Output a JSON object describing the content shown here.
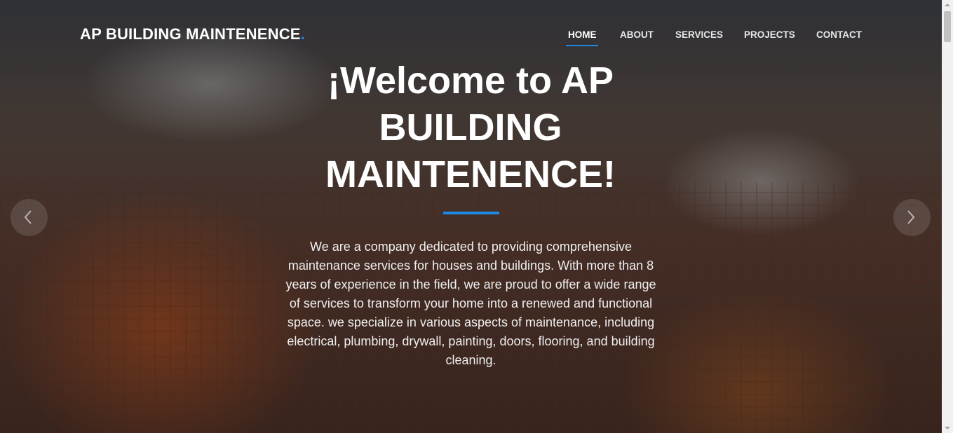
{
  "brand": {
    "name": "AP BUILDING MAINTENENCE",
    "dot": "."
  },
  "nav": {
    "items": [
      {
        "label": "HOME",
        "active": true
      },
      {
        "label": "ABOUT",
        "active": false
      },
      {
        "label": "SERVICES",
        "active": false
      },
      {
        "label": "PROJECTS",
        "active": false
      },
      {
        "label": "CONTACT",
        "active": false
      }
    ]
  },
  "hero": {
    "title": "¡Welcome to AP BUILDING MAINTENENCE!",
    "description": "We are a company dedicated to providing comprehensive maintenance services for houses and buildings. With more than 8 years of experience in the field, we are proud to offer a wide range of services to transform your home into a renewed and functional space. we specialize in various aspects of maintenance, including electrical, plumbing, drywall, painting, doors, flooring, and building cleaning."
  },
  "carousel": {
    "prev_icon": "chevron-left-icon",
    "next_icon": "chevron-right-icon"
  },
  "colors": {
    "accent": "#1e88e5",
    "text": "#ffffff"
  }
}
